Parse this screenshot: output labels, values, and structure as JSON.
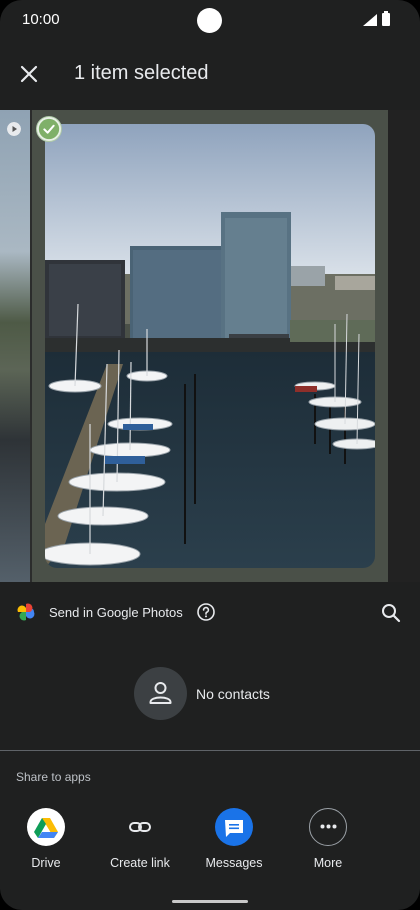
{
  "status": {
    "time": "10:00"
  },
  "header": {
    "title": "1 item selected"
  },
  "google_photos": {
    "label": "Send in Google Photos"
  },
  "contacts": {
    "empty_text": "No contacts"
  },
  "share": {
    "section_label": "Share to apps",
    "apps": [
      {
        "label": "Drive"
      },
      {
        "label": "Create link"
      },
      {
        "label": "Messages"
      },
      {
        "label": "More"
      }
    ]
  },
  "colors": {
    "background": "#1f2020",
    "text": "#e8eaed",
    "messages_blue": "#1a73e8"
  }
}
